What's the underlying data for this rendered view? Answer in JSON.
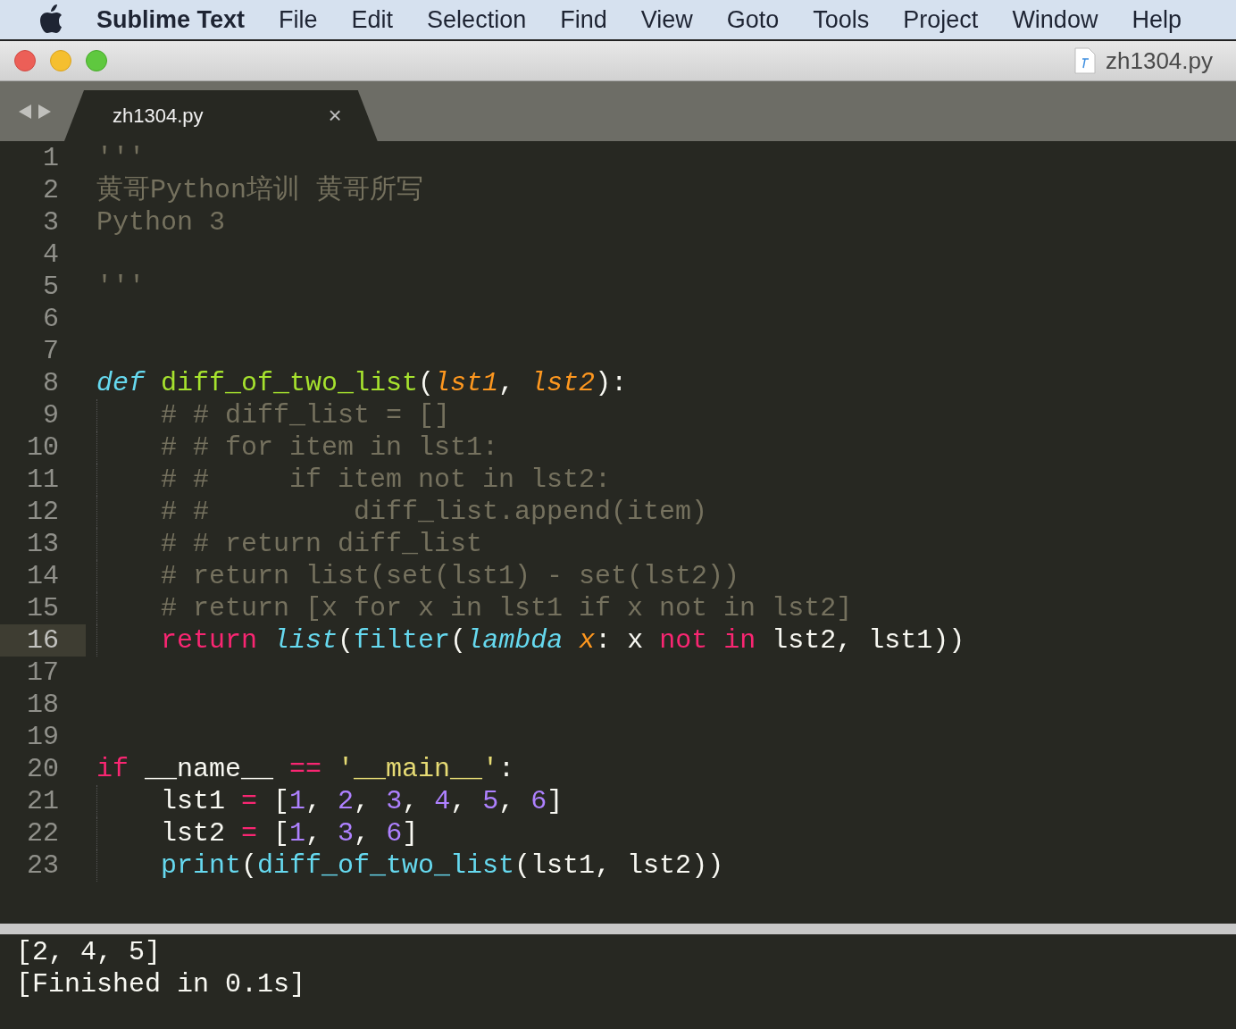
{
  "menu_bar": {
    "app_name": "Sublime Text",
    "items": [
      "File",
      "Edit",
      "Selection",
      "Find",
      "View",
      "Goto",
      "Tools",
      "Project",
      "Window",
      "Help"
    ]
  },
  "window": {
    "title": "zh1304.py"
  },
  "tabs": [
    {
      "label": "zh1304.py",
      "close": "×",
      "selected": true
    }
  ],
  "editor": {
    "lines": [
      {
        "number": "1",
        "current": false,
        "tokens": [
          {
            "text": "'''",
            "kind": "comment"
          }
        ]
      },
      {
        "number": "2",
        "current": false,
        "tokens": [
          {
            "text": "黄哥Python培训 黄哥所写",
            "kind": "comment"
          }
        ]
      },
      {
        "number": "3",
        "current": false,
        "tokens": [
          {
            "text": "Python 3",
            "kind": "comment"
          }
        ]
      },
      {
        "number": "4",
        "current": false
      },
      {
        "number": "5",
        "current": false,
        "tokens": [
          {
            "text": "'''",
            "kind": "comment"
          }
        ]
      },
      {
        "number": "6",
        "current": false
      },
      {
        "number": "7",
        "current": false
      },
      {
        "number": "8",
        "current": false,
        "tokens": [
          {
            "text": "def ",
            "kind": "storage"
          },
          {
            "text": "diff_of_two_list",
            "kind": "function"
          },
          {
            "text": "(",
            "kind": "plain"
          },
          {
            "text": "lst1",
            "kind": "param"
          },
          {
            "text": ", ",
            "kind": "plain"
          },
          {
            "text": "lst2",
            "kind": "param"
          },
          {
            "text": "):",
            "kind": "plain"
          }
        ]
      },
      {
        "number": "9",
        "current": false,
        "tokens": [
          {
            "text": "    # # diff_list = []",
            "kind": "comment"
          }
        ]
      },
      {
        "number": "10",
        "current": false,
        "tokens": [
          {
            "text": "    # # for item in lst1:",
            "kind": "comment"
          }
        ]
      },
      {
        "number": "11",
        "current": false,
        "tokens": [
          {
            "text": "    # #     if item not in lst2:",
            "kind": "comment"
          }
        ]
      },
      {
        "number": "12",
        "current": false,
        "tokens": [
          {
            "text": "    # #         diff_list.append(item)",
            "kind": "comment"
          }
        ]
      },
      {
        "number": "13",
        "current": false,
        "tokens": [
          {
            "text": "    # # return diff_list",
            "kind": "comment"
          }
        ]
      },
      {
        "number": "14",
        "current": false,
        "tokens": [
          {
            "text": "    # return list(set(lst1) - set(lst2))",
            "kind": "comment"
          }
        ]
      },
      {
        "number": "15",
        "current": false,
        "tokens": [
          {
            "text": "    # return [x for x in lst1 if x not in lst2]",
            "kind": "comment"
          }
        ]
      },
      {
        "number": "16",
        "current": true,
        "tokens": [
          {
            "text": "    return ",
            "kind": "keyword"
          },
          {
            "text": "list",
            "kind": "support"
          },
          {
            "text": "(",
            "kind": "plain"
          },
          {
            "text": "filter",
            "kind": "builtin"
          },
          {
            "text": "(",
            "kind": "plain"
          },
          {
            "text": "lambda ",
            "kind": "support"
          },
          {
            "text": "x",
            "kind": "param"
          },
          {
            "text": ": x ",
            "kind": "plain"
          },
          {
            "text": "not in",
            "kind": "keyword"
          },
          {
            "text": " lst2, lst1))",
            "kind": "plain"
          }
        ]
      },
      {
        "number": "17",
        "current": false
      },
      {
        "number": "18",
        "current": false
      },
      {
        "number": "19",
        "current": false
      },
      {
        "number": "20",
        "current": false,
        "tokens": [
          {
            "text": "if",
            "kind": "keyword"
          },
          {
            "text": " __name__ ",
            "kind": "plain"
          },
          {
            "text": "== ",
            "kind": "keyword"
          },
          {
            "text": "'__main__'",
            "kind": "string"
          },
          {
            "text": ":",
            "kind": "plain"
          }
        ]
      },
      {
        "number": "21",
        "current": false,
        "tokens": [
          {
            "text": "    lst1 ",
            "kind": "plain"
          },
          {
            "text": "=",
            "kind": "keyword"
          },
          {
            "text": " [",
            "kind": "plain"
          },
          {
            "text": "1",
            "kind": "number"
          },
          {
            "text": ", ",
            "kind": "plain"
          },
          {
            "text": "2",
            "kind": "number"
          },
          {
            "text": ", ",
            "kind": "plain"
          },
          {
            "text": "3",
            "kind": "number"
          },
          {
            "text": ", ",
            "kind": "plain"
          },
          {
            "text": "4",
            "kind": "number"
          },
          {
            "text": ", ",
            "kind": "plain"
          },
          {
            "text": "5",
            "kind": "number"
          },
          {
            "text": ", ",
            "kind": "plain"
          },
          {
            "text": "6",
            "kind": "number"
          },
          {
            "text": "]",
            "kind": "plain"
          }
        ]
      },
      {
        "number": "22",
        "current": false,
        "tokens": [
          {
            "text": "    lst2 ",
            "kind": "plain"
          },
          {
            "text": "=",
            "kind": "keyword"
          },
          {
            "text": " [",
            "kind": "plain"
          },
          {
            "text": "1",
            "kind": "number"
          },
          {
            "text": ", ",
            "kind": "plain"
          },
          {
            "text": "3",
            "kind": "number"
          },
          {
            "text": ", ",
            "kind": "plain"
          },
          {
            "text": "6",
            "kind": "number"
          },
          {
            "text": "]",
            "kind": "plain"
          }
        ]
      },
      {
        "number": "23",
        "current": false,
        "tokens": [
          {
            "text": "    print",
            "kind": "builtin"
          },
          {
            "text": "(",
            "kind": "plain"
          },
          {
            "text": "diff_of_two_list",
            "kind": "builtin"
          },
          {
            "text": "(lst1, lst2))",
            "kind": "plain"
          }
        ]
      }
    ]
  },
  "output": {
    "lines": [
      "[2, 4, 5]",
      "[Finished in 0.1s]"
    ]
  }
}
